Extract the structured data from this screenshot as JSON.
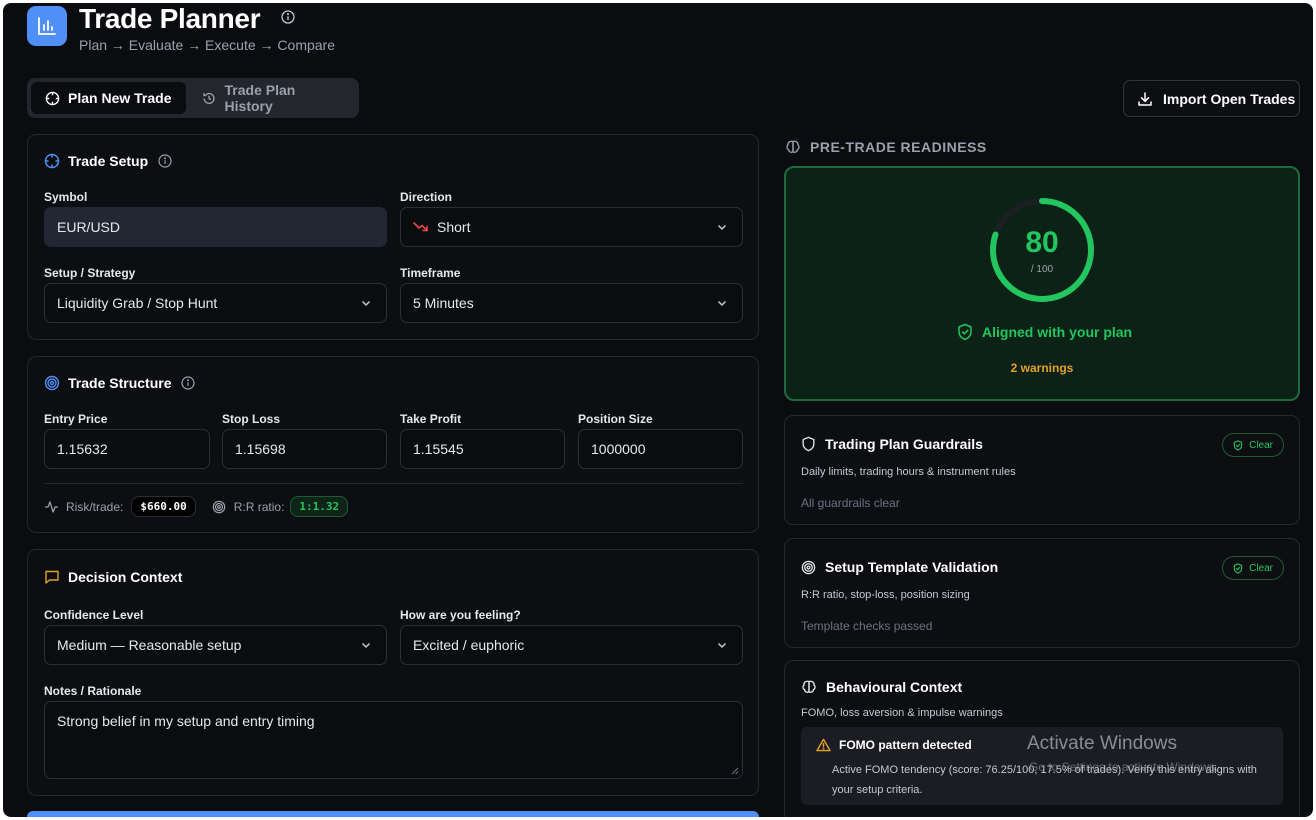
{
  "app": {
    "title": "Trade Planner",
    "subtitle": "Plan → Evaluate → Execute → Compare",
    "accent": "#4f8ff7"
  },
  "tabs": [
    {
      "label": "Plan New Trade",
      "icon": "crosshair-icon",
      "active": true
    },
    {
      "label": "Trade Plan History",
      "icon": "history-icon",
      "active": false
    }
  ],
  "import_button": {
    "label": "Import Open Trades",
    "icon": "download-icon"
  },
  "trade_setup": {
    "title": "Trade Setup",
    "symbol_label": "Symbol",
    "symbol_value": "EUR/USD",
    "direction_label": "Direction",
    "direction_value": "Short",
    "strategy_label": "Setup / Strategy",
    "strategy_value": "Liquidity Grab / Stop Hunt",
    "timeframe_label": "Timeframe",
    "timeframe_value": "5 Minutes"
  },
  "trade_structure": {
    "title": "Trade Structure",
    "entry_label": "Entry Price",
    "entry_value": "1.15632",
    "stop_label": "Stop Loss",
    "stop_value": "1.15698",
    "tp_label": "Take Profit",
    "tp_value": "1.15545",
    "size_label": "Position Size",
    "size_value": "1000000",
    "risk_label": "Risk/trade:",
    "risk_value": "$660.00",
    "rr_label": "R:R ratio:",
    "rr_value": "1:1.32"
  },
  "decision_context": {
    "title": "Decision Context",
    "confidence_label": "Confidence Level",
    "confidence_value": "Medium — Reasonable setup",
    "feeling_label": "How are you feeling?",
    "feeling_value": "Excited / euphoric",
    "notes_label": "Notes / Rationale",
    "notes_value": "Strong belief in my setup and entry timing"
  },
  "readiness": {
    "heading": "PRE-TRADE READINESS",
    "score": "80",
    "score_max": "/ 100",
    "score_fraction": 0.8,
    "status": "Aligned with your plan",
    "warnings": "2 warnings",
    "color": "#22c55e"
  },
  "guardrails": {
    "title": "Trading Plan Guardrails",
    "subtitle": "Daily limits, trading hours & instrument rules",
    "status": "All guardrails clear",
    "badge": "Clear"
  },
  "template_validation": {
    "title": "Setup Template Validation",
    "subtitle": "R:R ratio, stop-loss, position sizing",
    "status": "Template checks passed",
    "badge": "Clear"
  },
  "behavioural": {
    "title": "Behavioural Context",
    "subtitle": "FOMO, loss aversion & impulse warnings",
    "alert_title": "FOMO pattern detected",
    "alert_text": "Active FOMO tendency (score: 76.25/100, 17.5% of trades). Verify this entry aligns with your setup criteria."
  },
  "watermark": {
    "title": "Activate Windows",
    "subtitle": "Go to Settings to activate Windows."
  }
}
